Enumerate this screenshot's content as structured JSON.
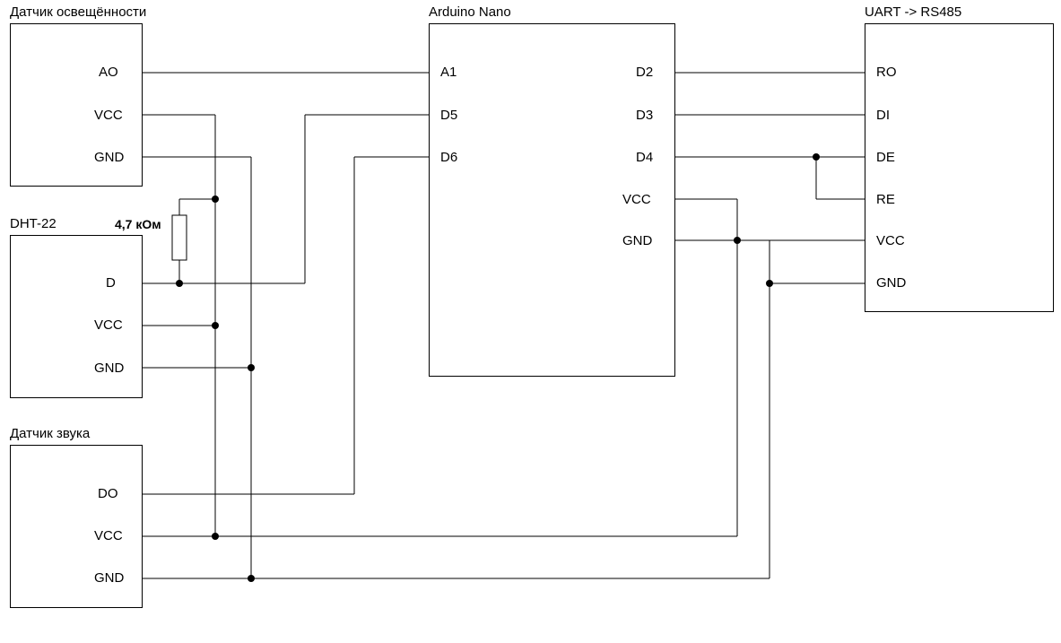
{
  "components": {
    "light": {
      "title": "Датчик освещённости",
      "pins": {
        "ao": "AO",
        "vcc": "VCC",
        "gnd": "GND"
      }
    },
    "dht": {
      "title": "DHT-22",
      "pins": {
        "d": "D",
        "vcc": "VCC",
        "gnd": "GND"
      }
    },
    "sound": {
      "title": "Датчик звука",
      "pins": {
        "do": "DO",
        "vcc": "VCC",
        "gnd": "GND"
      }
    },
    "arduino": {
      "title": "Arduino Nano",
      "left": {
        "a1": "A1",
        "d5": "D5",
        "d6": "D6"
      },
      "right": {
        "d2": "D2",
        "d3": "D3",
        "d4": "D4",
        "vcc": "VCC",
        "gnd": "GND"
      }
    },
    "rs485": {
      "title": "UART -> RS485",
      "pins": {
        "ro": "RO",
        "di": "DI",
        "de": "DE",
        "re": "RE",
        "vcc": "VCC",
        "gnd": "GND"
      }
    }
  },
  "resistor_label": "4,7 кОм"
}
